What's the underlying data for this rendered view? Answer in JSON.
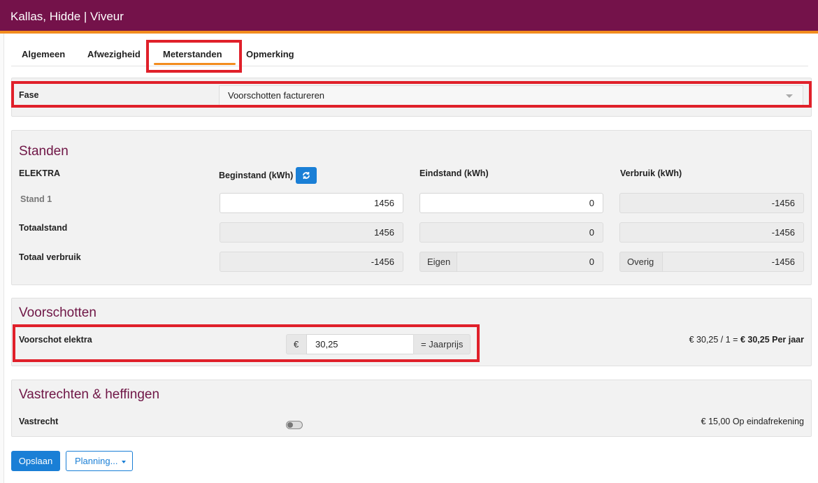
{
  "header": {
    "title": "Kallas, Hidde | Viveur"
  },
  "tabs": [
    {
      "label": "Algemeen"
    },
    {
      "label": "Afwezigheid"
    },
    {
      "label": "Meterstanden",
      "active": true
    },
    {
      "label": "Opmerking"
    }
  ],
  "fase": {
    "label": "Fase",
    "value": "Voorschotten factureren"
  },
  "standen": {
    "title": "Standen",
    "group": "ELEKTRA",
    "col_begin": "Beginstand (kWh)",
    "col_eind": "Eindstand (kWh)",
    "col_verbruik": "Verbruik (kWh)",
    "rows": [
      {
        "label": "Stand 1",
        "begin": "1456",
        "eind": "0",
        "verbruik": "-1456"
      },
      {
        "label": "Totaalstand",
        "begin": "1456",
        "eind": "0",
        "verbruik": "-1456"
      },
      {
        "label": "Totaal verbruik",
        "begin": "-1456",
        "eind_prefix": "Eigen",
        "eind": "0",
        "verbruik_prefix": "Overig",
        "verbruik": "-1456"
      }
    ]
  },
  "voorschotten": {
    "title": "Voorschotten",
    "label": "Voorschot elektra",
    "currency": "€",
    "value": "30,25",
    "suffix": "= Jaarprijs",
    "summary_prefix": "€ 30,25 / 1 = ",
    "summary_bold": "€ 30,25 Per jaar"
  },
  "vastrechten": {
    "title": "Vastrechten & heffingen",
    "label": "Vastrecht",
    "amount": "€ 15,00 Op eindafrekening"
  },
  "footer": {
    "save": "Opslaan",
    "planning": "Planning..."
  },
  "colors": {
    "brand": "#74124a",
    "accent": "#f28c1e",
    "primary": "#1a7fd6",
    "highlight": "#e0202a"
  }
}
